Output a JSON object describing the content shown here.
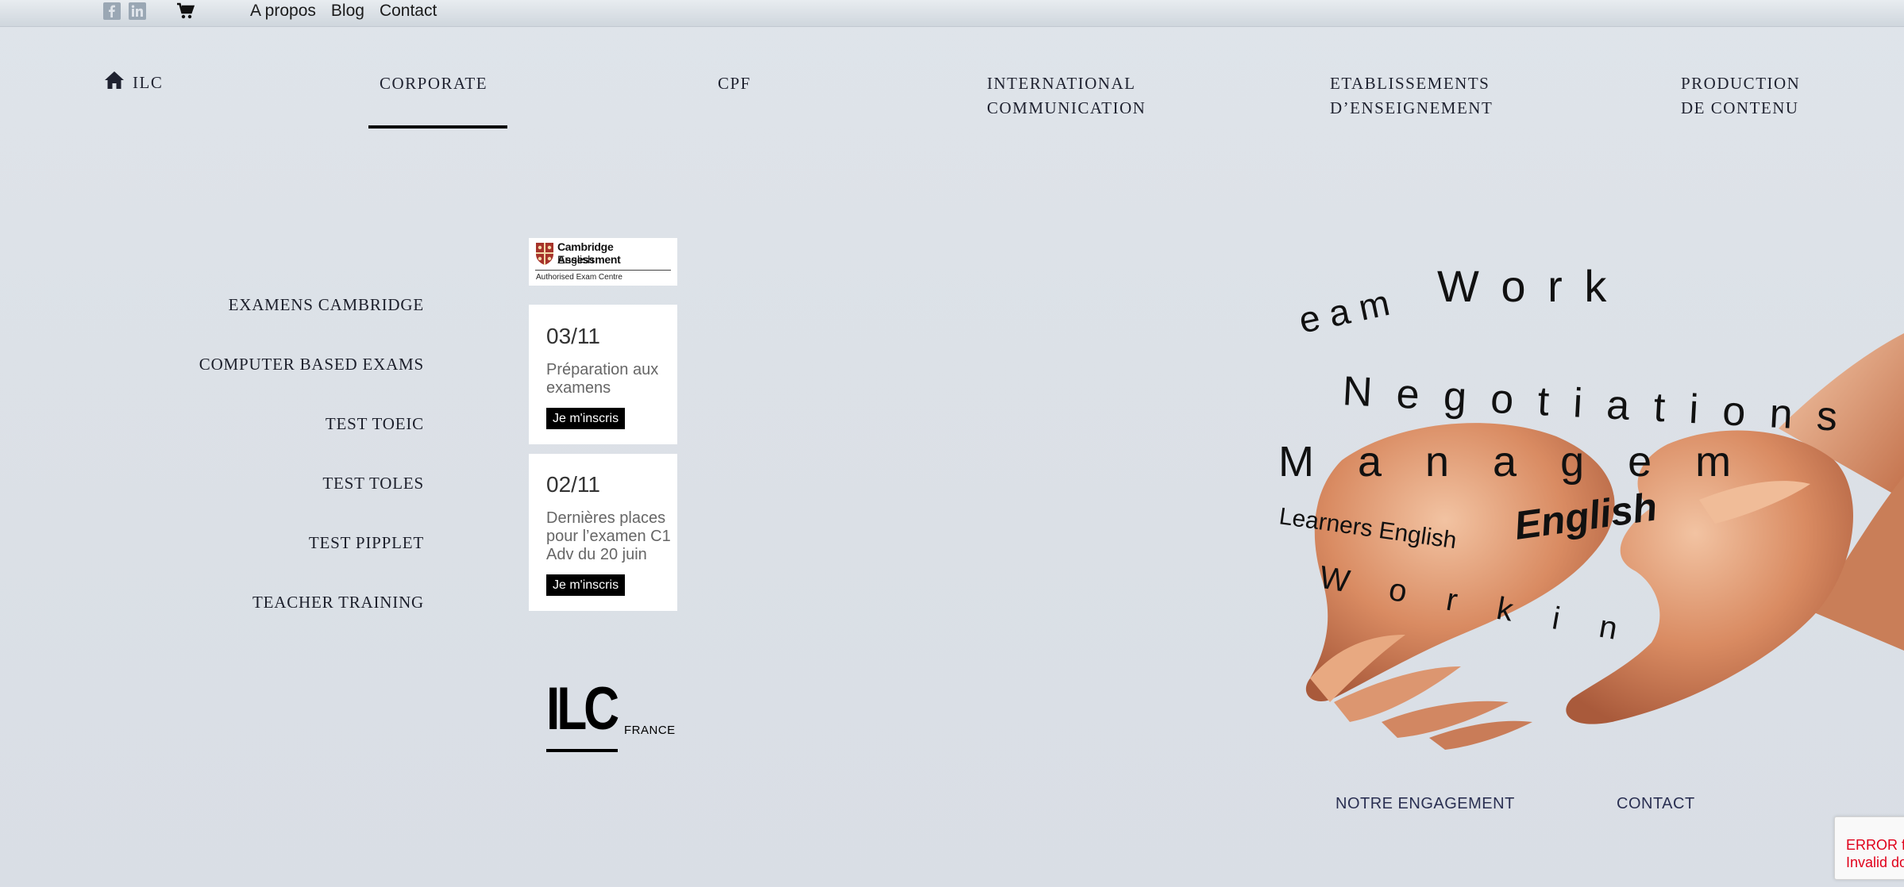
{
  "topbar": {
    "links": [
      "A propos",
      "Blog",
      "Contact"
    ],
    "icons": [
      "facebook-icon",
      "linkedin-icon",
      "cart-icon"
    ]
  },
  "nav": {
    "home_label": "ILC",
    "items": [
      {
        "line1": "CORPORATE",
        "line2": ""
      },
      {
        "line1": "CPF",
        "line2": ""
      },
      {
        "line1": "INTERNATIONAL",
        "line2": "COMMUNICATION"
      },
      {
        "line1": "ETABLISSEMENTS",
        "line2": "D’ENSEIGNEMENT"
      },
      {
        "line1": "PRODUCTION",
        "line2": "DE CONTENU"
      }
    ],
    "active": "CORPORATE"
  },
  "submenu": [
    "EXAMENS CAMBRIDGE",
    "COMPUTER BASED EXAMS",
    "TEST TOEIC",
    "TEST TOLES",
    "TEST PIPPLET",
    "TEACHER TRAINING"
  ],
  "cambridge_logo": {
    "line1": "Cambridge Assessment",
    "line2": "English",
    "line3": "Authorised Exam Centre"
  },
  "events": [
    {
      "date": "03/11",
      "text": "Préparation aux examens",
      "button": "Je m'inscris"
    },
    {
      "date": "02/11",
      "text": "Dernières places pour l’examen C1 Adv du 20 juin",
      "button": "Je m'inscris"
    }
  ],
  "ilc_logo": {
    "main": "ILC",
    "sub": "FRANCE"
  },
  "hero_words": [
    "Team Working",
    "Negotiations",
    "Management",
    "Learners English",
    "English",
    "Working"
  ],
  "footer": {
    "links": [
      "NOTRE ENGAGEMENT",
      "CONTACT"
    ]
  },
  "recaptcha": {
    "line1": "ERROR fo",
    "line2": "Invalid do"
  },
  "colors": {
    "accent": "#000000",
    "text": "#1f2230",
    "error": "#e0001a"
  }
}
